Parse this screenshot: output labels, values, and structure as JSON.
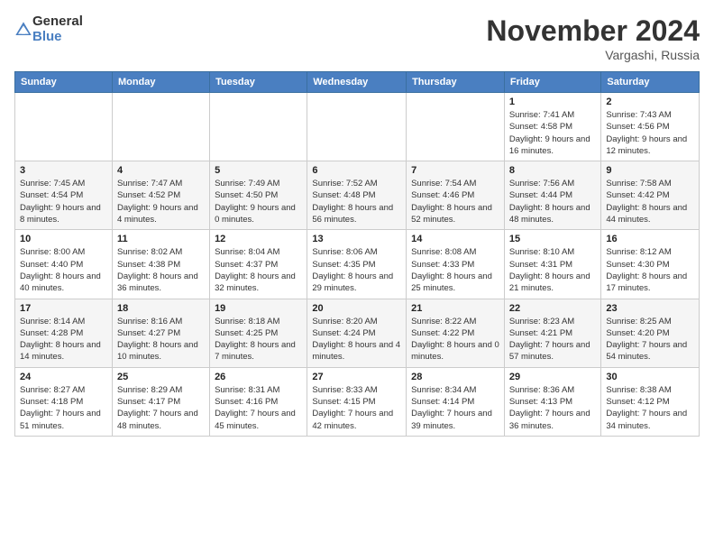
{
  "logo": {
    "general": "General",
    "blue": "Blue"
  },
  "title": "November 2024",
  "location": "Vargashi, Russia",
  "days_header": [
    "Sunday",
    "Monday",
    "Tuesday",
    "Wednesday",
    "Thursday",
    "Friday",
    "Saturday"
  ],
  "weeks": [
    [
      {
        "day": "",
        "info": ""
      },
      {
        "day": "",
        "info": ""
      },
      {
        "day": "",
        "info": ""
      },
      {
        "day": "",
        "info": ""
      },
      {
        "day": "",
        "info": ""
      },
      {
        "day": "1",
        "info": "Sunrise: 7:41 AM\nSunset: 4:58 PM\nDaylight: 9 hours and 16 minutes."
      },
      {
        "day": "2",
        "info": "Sunrise: 7:43 AM\nSunset: 4:56 PM\nDaylight: 9 hours and 12 minutes."
      }
    ],
    [
      {
        "day": "3",
        "info": "Sunrise: 7:45 AM\nSunset: 4:54 PM\nDaylight: 9 hours and 8 minutes."
      },
      {
        "day": "4",
        "info": "Sunrise: 7:47 AM\nSunset: 4:52 PM\nDaylight: 9 hours and 4 minutes."
      },
      {
        "day": "5",
        "info": "Sunrise: 7:49 AM\nSunset: 4:50 PM\nDaylight: 9 hours and 0 minutes."
      },
      {
        "day": "6",
        "info": "Sunrise: 7:52 AM\nSunset: 4:48 PM\nDaylight: 8 hours and 56 minutes."
      },
      {
        "day": "7",
        "info": "Sunrise: 7:54 AM\nSunset: 4:46 PM\nDaylight: 8 hours and 52 minutes."
      },
      {
        "day": "8",
        "info": "Sunrise: 7:56 AM\nSunset: 4:44 PM\nDaylight: 8 hours and 48 minutes."
      },
      {
        "day": "9",
        "info": "Sunrise: 7:58 AM\nSunset: 4:42 PM\nDaylight: 8 hours and 44 minutes."
      }
    ],
    [
      {
        "day": "10",
        "info": "Sunrise: 8:00 AM\nSunset: 4:40 PM\nDaylight: 8 hours and 40 minutes."
      },
      {
        "day": "11",
        "info": "Sunrise: 8:02 AM\nSunset: 4:38 PM\nDaylight: 8 hours and 36 minutes."
      },
      {
        "day": "12",
        "info": "Sunrise: 8:04 AM\nSunset: 4:37 PM\nDaylight: 8 hours and 32 minutes."
      },
      {
        "day": "13",
        "info": "Sunrise: 8:06 AM\nSunset: 4:35 PM\nDaylight: 8 hours and 29 minutes."
      },
      {
        "day": "14",
        "info": "Sunrise: 8:08 AM\nSunset: 4:33 PM\nDaylight: 8 hours and 25 minutes."
      },
      {
        "day": "15",
        "info": "Sunrise: 8:10 AM\nSunset: 4:31 PM\nDaylight: 8 hours and 21 minutes."
      },
      {
        "day": "16",
        "info": "Sunrise: 8:12 AM\nSunset: 4:30 PM\nDaylight: 8 hours and 17 minutes."
      }
    ],
    [
      {
        "day": "17",
        "info": "Sunrise: 8:14 AM\nSunset: 4:28 PM\nDaylight: 8 hours and 14 minutes."
      },
      {
        "day": "18",
        "info": "Sunrise: 8:16 AM\nSunset: 4:27 PM\nDaylight: 8 hours and 10 minutes."
      },
      {
        "day": "19",
        "info": "Sunrise: 8:18 AM\nSunset: 4:25 PM\nDaylight: 8 hours and 7 minutes."
      },
      {
        "day": "20",
        "info": "Sunrise: 8:20 AM\nSunset: 4:24 PM\nDaylight: 8 hours and 4 minutes."
      },
      {
        "day": "21",
        "info": "Sunrise: 8:22 AM\nSunset: 4:22 PM\nDaylight: 8 hours and 0 minutes."
      },
      {
        "day": "22",
        "info": "Sunrise: 8:23 AM\nSunset: 4:21 PM\nDaylight: 7 hours and 57 minutes."
      },
      {
        "day": "23",
        "info": "Sunrise: 8:25 AM\nSunset: 4:20 PM\nDaylight: 7 hours and 54 minutes."
      }
    ],
    [
      {
        "day": "24",
        "info": "Sunrise: 8:27 AM\nSunset: 4:18 PM\nDaylight: 7 hours and 51 minutes."
      },
      {
        "day": "25",
        "info": "Sunrise: 8:29 AM\nSunset: 4:17 PM\nDaylight: 7 hours and 48 minutes."
      },
      {
        "day": "26",
        "info": "Sunrise: 8:31 AM\nSunset: 4:16 PM\nDaylight: 7 hours and 45 minutes."
      },
      {
        "day": "27",
        "info": "Sunrise: 8:33 AM\nSunset: 4:15 PM\nDaylight: 7 hours and 42 minutes."
      },
      {
        "day": "28",
        "info": "Sunrise: 8:34 AM\nSunset: 4:14 PM\nDaylight: 7 hours and 39 minutes."
      },
      {
        "day": "29",
        "info": "Sunrise: 8:36 AM\nSunset: 4:13 PM\nDaylight: 7 hours and 36 minutes."
      },
      {
        "day": "30",
        "info": "Sunrise: 8:38 AM\nSunset: 4:12 PM\nDaylight: 7 hours and 34 minutes."
      }
    ]
  ]
}
